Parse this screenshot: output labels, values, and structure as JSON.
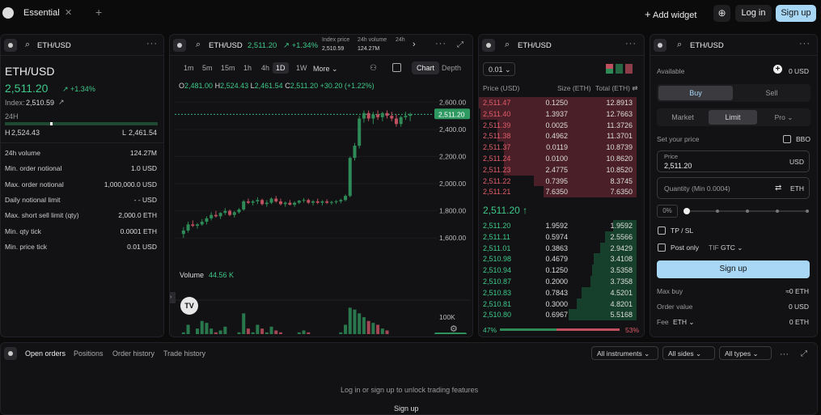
{
  "topbar": {
    "tab": "Essential",
    "close": "✕",
    "add": "+",
    "add_widget": "Add widget",
    "login": "Log in",
    "signup": "Sign up"
  },
  "left": {
    "symbol": "ETH/USD",
    "more": "···",
    "title": "ETH/USD",
    "price": "2,511.20",
    "change": "↗ +1.34%",
    "index_label": "Index:",
    "index_value": "2,510.59",
    "range_label": "24H",
    "high_label": "H",
    "high": "2,524.43",
    "low_label": "L",
    "low": "2,461.54",
    "range_position": 0.3,
    "stats": [
      {
        "label": "24h volume",
        "value": "124.27M"
      },
      {
        "label": "Min. order notional",
        "value": "1.0 USD"
      },
      {
        "label": "Max. order notional",
        "value": "1,000,000.0 USD"
      },
      {
        "label": "Daily notional limit",
        "value": "- - USD"
      },
      {
        "label": "Max. short sell limit (qty)",
        "value": "2,000.0 ETH"
      },
      {
        "label": "Min. qty tick",
        "value": "0.0001 ETH"
      },
      {
        "label": "Min. price tick",
        "value": "0.01 USD"
      }
    ]
  },
  "chart": {
    "symbol": "ETH/USD",
    "price": "2,511.20",
    "change": "↗ +1.34%",
    "index_label": "Index price",
    "index_value": "2,510.59",
    "vol_label": "24h volume",
    "vol_value": "124.27M",
    "extra_label": "24h",
    "more": "···",
    "intervals": [
      "1m",
      "5m",
      "15m",
      "1h",
      "4h",
      "1D",
      "1W"
    ],
    "active_interval": "1D",
    "more_menu": "More ⌄",
    "tab_chart": "Chart",
    "tab_depth": "Depth",
    "ohlc": {
      "o_label": "O",
      "o": "2,481.00",
      "h_label": "H",
      "h": "2,524.43",
      "l_label": "L",
      "l": "2,461.54",
      "c_label": "C",
      "c": "2,511.20",
      "chg": "+30.20 (+1.22%)"
    },
    "y_ticks": [
      "2,600.00",
      "2,400.00",
      "2,200.00",
      "2,000.00",
      "1,800.00",
      "1,600.00"
    ],
    "last_price_tag": "2,511.20",
    "volume_label": "Volume",
    "volume_value": "44.56 K",
    "vol_tick": "100K",
    "vol_tag": "44.56 K",
    "x_ticks": [
      "Jul",
      "15",
      "Aug",
      "15",
      "Sep",
      "15"
    ],
    "colors": {
      "up": "#2e8b57",
      "down": "#c05060"
    }
  },
  "chart_data": {
    "type": "candlestick",
    "ylim": [
      1500,
      2650
    ],
    "volume_ylim": [
      0,
      130000
    ],
    "candles": [
      [
        1630,
        1680,
        1600,
        1655,
        60000
      ],
      [
        1655,
        1720,
        1640,
        1700,
        80000
      ],
      [
        1700,
        1730,
        1680,
        1690,
        50000
      ],
      [
        1690,
        1710,
        1670,
        1700,
        70000
      ],
      [
        1700,
        1740,
        1690,
        1720,
        90000
      ],
      [
        1720,
        1760,
        1700,
        1745,
        85000
      ],
      [
        1745,
        1790,
        1730,
        1770,
        70000
      ],
      [
        1770,
        1800,
        1750,
        1760,
        60000
      ],
      [
        1760,
        1790,
        1740,
        1785,
        65000
      ],
      [
        1785,
        1820,
        1770,
        1800,
        75000
      ],
      [
        1800,
        1810,
        1760,
        1770,
        55000
      ],
      [
        1770,
        1800,
        1750,
        1790,
        50000
      ],
      [
        1790,
        1820,
        1780,
        1810,
        60000
      ],
      [
        1810,
        1880,
        1800,
        1870,
        110000
      ],
      [
        1870,
        1890,
        1850,
        1860,
        70000
      ],
      [
        1860,
        1880,
        1840,
        1870,
        60000
      ],
      [
        1870,
        1900,
        1850,
        1880,
        80000
      ],
      [
        1880,
        1890,
        1840,
        1850,
        70000
      ],
      [
        1850,
        1880,
        1830,
        1860,
        60000
      ],
      [
        1860,
        1900,
        1850,
        1890,
        75000
      ],
      [
        1890,
        1910,
        1860,
        1870,
        65000
      ],
      [
        1870,
        1890,
        1840,
        1850,
        60000
      ],
      [
        1850,
        1870,
        1830,
        1860,
        55000
      ],
      [
        1860,
        1880,
        1840,
        1845,
        50000
      ],
      [
        1845,
        1870,
        1830,
        1860,
        55000
      ],
      [
        1860,
        1880,
        1850,
        1875,
        60000
      ],
      [
        1875,
        1895,
        1860,
        1880,
        65000
      ],
      [
        1880,
        1890,
        1850,
        1860,
        60000
      ],
      [
        1860,
        1880,
        1840,
        1870,
        50000
      ],
      [
        1870,
        1890,
        1850,
        1860,
        55000
      ],
      [
        1860,
        1880,
        1840,
        1870,
        50000
      ],
      [
        1870,
        1885,
        1850,
        1860,
        45000
      ],
      [
        1860,
        1875,
        1845,
        1865,
        50000
      ],
      [
        1865,
        1880,
        1850,
        1870,
        55000
      ],
      [
        1870,
        1890,
        1855,
        1880,
        60000
      ],
      [
        1880,
        1920,
        1870,
        1910,
        80000
      ],
      [
        1910,
        2200,
        1900,
        2190,
        125000
      ],
      [
        2190,
        2300,
        2170,
        2280,
        120000
      ],
      [
        2280,
        2500,
        2260,
        2480,
        110000
      ],
      [
        2480,
        2540,
        2450,
        2520,
        100000
      ],
      [
        2520,
        2540,
        2460,
        2480,
        90000
      ],
      [
        2480,
        2530,
        2440,
        2510,
        85000
      ],
      [
        2510,
        2540,
        2470,
        2490,
        80000
      ],
      [
        2490,
        2530,
        2460,
        2520,
        70000
      ],
      [
        2520,
        2540,
        2480,
        2500,
        65000
      ],
      [
        2500,
        2530,
        2460,
        2480,
        55000
      ],
      [
        2480,
        2510,
        2420,
        2440,
        50000
      ],
      [
        2440,
        2500,
        2420,
        2490,
        45000
      ],
      [
        2490,
        2530,
        2470,
        2500,
        40000
      ],
      [
        2500,
        2524,
        2461,
        2511,
        20000
      ]
    ]
  },
  "orderbook": {
    "symbol": "ETH/USD",
    "more": "···",
    "tick": "0.01 ⌄",
    "col_price": "Price (USD)",
    "col_size": "Size (ETH)",
    "col_total": "Total (ETH) ⇄",
    "asks": [
      {
        "p": "2,511.47",
        "s": "0.1250",
        "t": "12.8913",
        "depth": 1.0
      },
      {
        "p": "2,511.40",
        "s": "1.3937",
        "t": "12.7663",
        "depth": 0.99
      },
      {
        "p": "2,511.39",
        "s": "0.0025",
        "t": "11.3726",
        "depth": 0.88
      },
      {
        "p": "2,511.38",
        "s": "0.4962",
        "t": "11.3701",
        "depth": 0.88
      },
      {
        "p": "2,511.37",
        "s": "0.0119",
        "t": "10.8739",
        "depth": 0.84
      },
      {
        "p": "2,511.24",
        "s": "0.0100",
        "t": "10.8620",
        "depth": 0.84
      },
      {
        "p": "2,511.23",
        "s": "2.4775",
        "t": "10.8520",
        "depth": 0.84
      },
      {
        "p": "2,511.22",
        "s": "0.7395",
        "t": "8.3745",
        "depth": 0.65
      },
      {
        "p": "2,511.21",
        "s": "7.6350",
        "t": "7.6350",
        "depth": 0.59
      }
    ],
    "mid": "2,511.20 ↑",
    "bids": [
      {
        "p": "2,511.20",
        "s": "1.9592",
        "t": "1.9592",
        "depth": 0.15
      },
      {
        "p": "2,511.11",
        "s": "0.5974",
        "t": "2.5566",
        "depth": 0.2
      },
      {
        "p": "2,511.01",
        "s": "0.3863",
        "t": "2.9429",
        "depth": 0.23
      },
      {
        "p": "2,510.98",
        "s": "0.4679",
        "t": "3.4108",
        "depth": 0.27
      },
      {
        "p": "2,510.94",
        "s": "0.1250",
        "t": "3.5358",
        "depth": 0.28
      },
      {
        "p": "2,510.87",
        "s": "0.2000",
        "t": "3.7358",
        "depth": 0.29
      },
      {
        "p": "2,510.83",
        "s": "0.7843",
        "t": "4.5201",
        "depth": 0.35
      },
      {
        "p": "2,510.81",
        "s": "0.3000",
        "t": "4.8201",
        "depth": 0.38
      },
      {
        "p": "2,510.80",
        "s": "0.6967",
        "t": "5.5168",
        "depth": 0.43
      }
    ],
    "bid_pct": "47%",
    "ask_pct": "53%",
    "bid_share": 0.47
  },
  "order": {
    "symbol": "ETH/USD",
    "more": "···",
    "available_label": "Available",
    "available_value": "0 USD",
    "add": "+",
    "buy": "Buy",
    "sell": "Sell",
    "market": "Market",
    "limit": "Limit",
    "pro": "Pro ⌄",
    "set_price": "Set your price",
    "bbo": "BBO",
    "price_label": "Price",
    "price_value": "2,511.20",
    "price_unit": "USD",
    "qty_placeholder": "Quantity (Min 0.0004)",
    "qty_swap": "⇄",
    "qty_unit": "ETH",
    "pct": "0%",
    "slider_level": 0,
    "tpsl": "TP / SL",
    "post_only": "Post only",
    "tif_label": "TIF",
    "tif_value": "GTC ⌄",
    "signup": "Sign up",
    "max_buy_label": "Max buy",
    "max_buy_value": "≈0 ETH",
    "order_value_label": "Order value",
    "order_value_value": "0 USD",
    "fee_label": "Fee",
    "fee_unit": "ETH ⌄",
    "fee_value": "0 ETH"
  },
  "bottom": {
    "tabs": [
      "Open orders",
      "Positions",
      "Order history",
      "Trade history"
    ],
    "filters": [
      "All instruments ⌄",
      "All sides ⌄",
      "All types ⌄"
    ],
    "more": "···",
    "message": "Log in or sign up to unlock trading features",
    "partial": "Sign up"
  }
}
